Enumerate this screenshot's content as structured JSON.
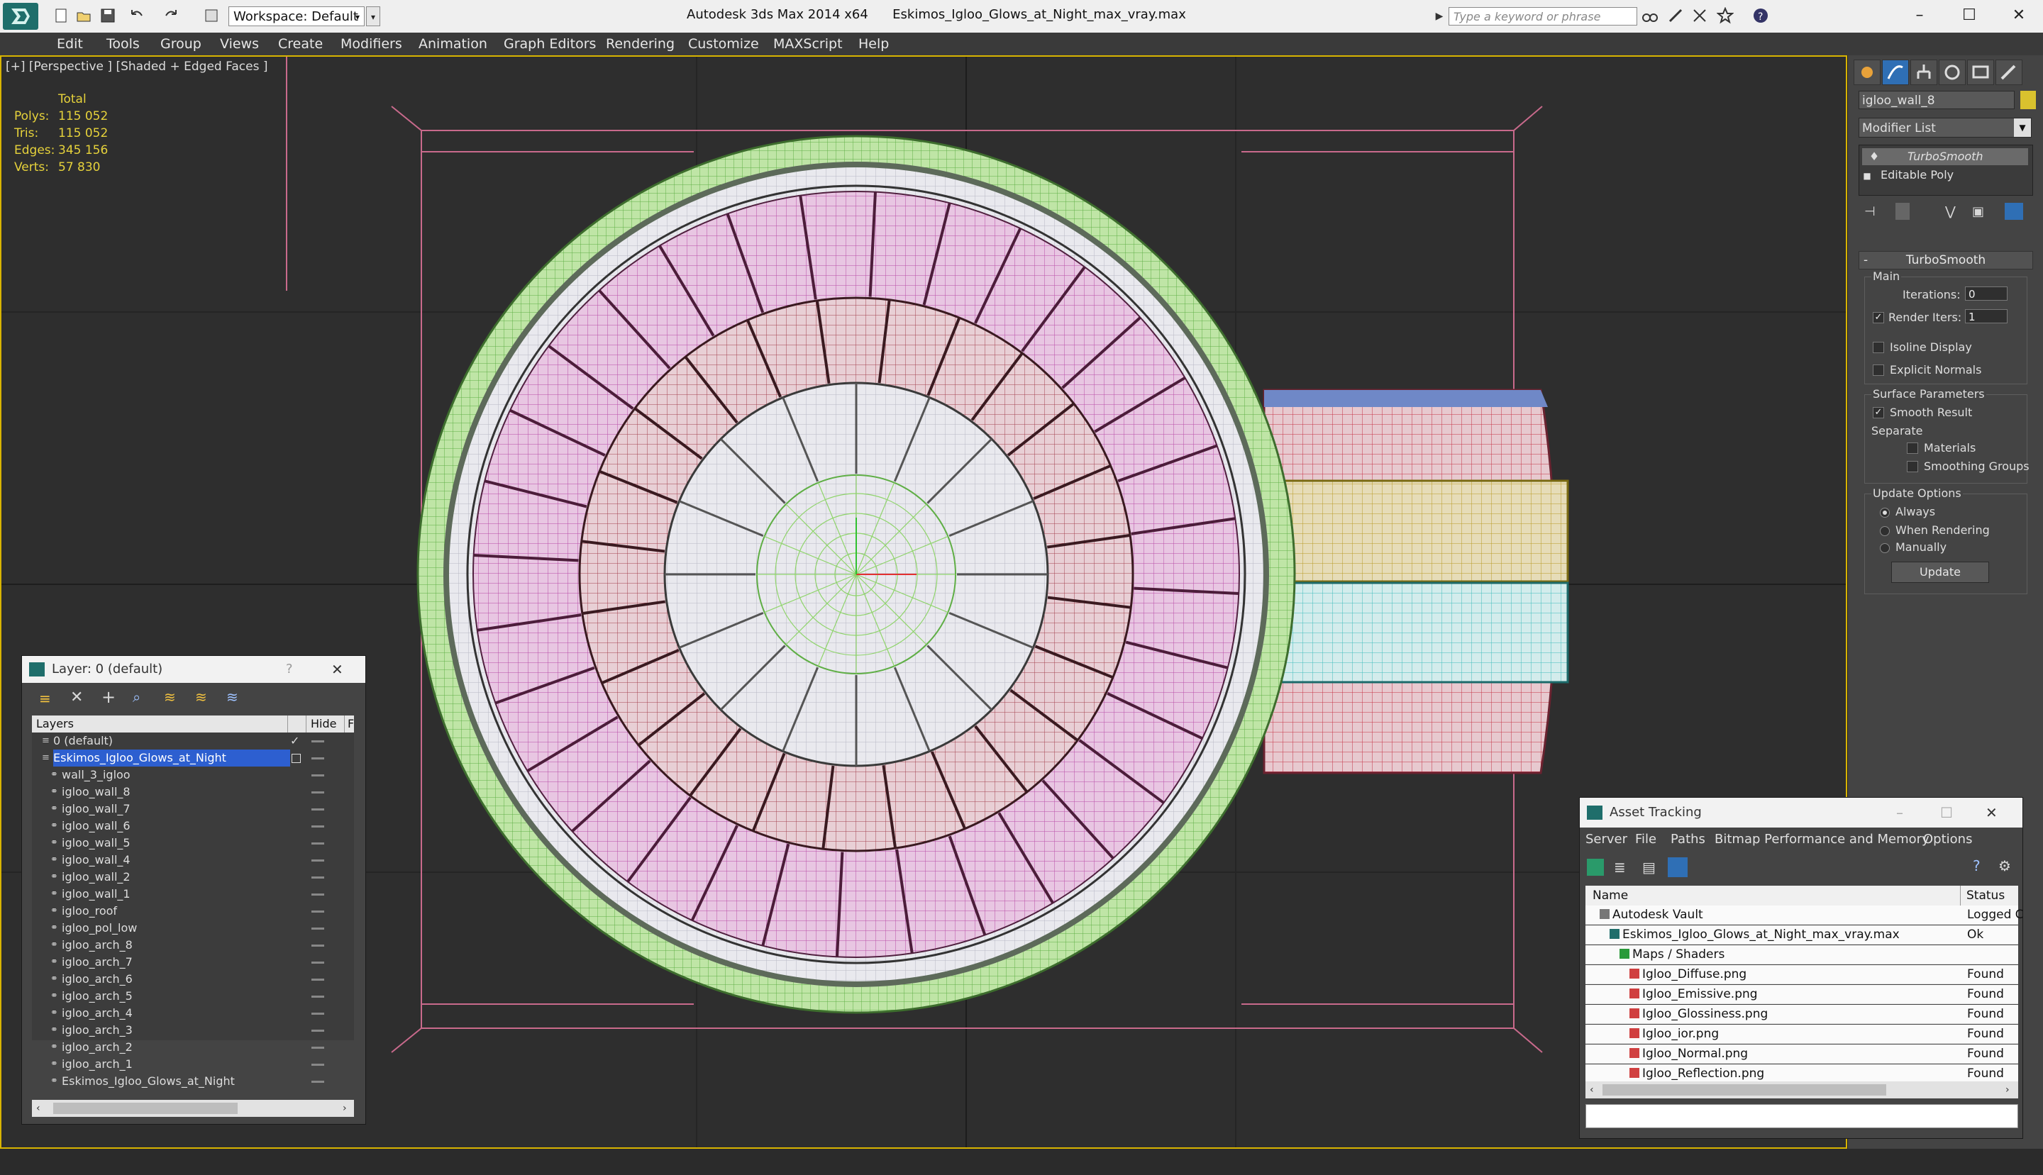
{
  "titlebar": {
    "workspace": "Workspace: Default",
    "title_app": "Autodesk 3ds Max  2014 x64",
    "title_file": "Eskimos_Igloo_Glows_at_Night_max_vray.max",
    "search_placeholder": "Type a keyword or phrase"
  },
  "menu": [
    "Edit",
    "Tools",
    "Group",
    "Views",
    "Create",
    "Modifiers",
    "Animation",
    "Graph Editors",
    "Rendering",
    "Customize",
    "MAXScript",
    "Help"
  ],
  "viewport": {
    "label": "[+] [Perspective ] [Shaded + Edged Faces ]",
    "stats_header": "Total",
    "stats": [
      {
        "key": "Polys:",
        "value": "115 052"
      },
      {
        "key": "Tris:",
        "value": "115 052"
      },
      {
        "key": "Edges:",
        "value": "345 156"
      },
      {
        "key": "Verts:",
        "value": "57 830"
      }
    ]
  },
  "command_panel": {
    "object_name": "igloo_wall_8",
    "object_color": "#d9c22e",
    "modifier_list": "Modifier List",
    "stack": [
      "TurboSmooth",
      "Editable Poly"
    ],
    "rollout": "TurboSmooth",
    "main_group": "Main",
    "iterations_label": "Iterations:",
    "iterations_value": "0",
    "render_iters_label": "Render Iters:",
    "render_iters_value": "1",
    "isoline": "Isoline Display",
    "explicit_normals": "Explicit Normals",
    "surface_params": "Surface Parameters",
    "smooth_result": "Smooth Result",
    "separate": "Separate",
    "materials": "Materials",
    "smoothing_groups": "Smoothing Groups",
    "update_options": "Update Options",
    "always": "Always",
    "when_rendering": "When Rendering",
    "manually": "Manually",
    "update_btn": "Update"
  },
  "layer_window": {
    "title": "Layer: 0 (default)",
    "help": "?",
    "col_layers": "Layers",
    "col_hide": "Hide",
    "col_f": "F",
    "rows": [
      {
        "name": "0 (default)",
        "indent": 1,
        "check": "✓"
      },
      {
        "name": "Eskimos_Igloo_Glows_at_Night",
        "indent": 1,
        "selected": true
      },
      {
        "name": "wall_3_igloo",
        "indent": 2
      },
      {
        "name": "igloo_wall_8",
        "indent": 2
      },
      {
        "name": "igloo_wall_7",
        "indent": 2
      },
      {
        "name": "igloo_wall_6",
        "indent": 2
      },
      {
        "name": "igloo_wall_5",
        "indent": 2
      },
      {
        "name": "igloo_wall_4",
        "indent": 2
      },
      {
        "name": "igloo_wall_2",
        "indent": 2
      },
      {
        "name": "igloo_wall_1",
        "indent": 2
      },
      {
        "name": "igloo_roof",
        "indent": 2
      },
      {
        "name": "igloo_pol_low",
        "indent": 2
      },
      {
        "name": "igloo_arch_8",
        "indent": 2
      },
      {
        "name": "igloo_arch_7",
        "indent": 2
      },
      {
        "name": "igloo_arch_6",
        "indent": 2
      },
      {
        "name": "igloo_arch_5",
        "indent": 2
      },
      {
        "name": "igloo_arch_4",
        "indent": 2
      },
      {
        "name": "igloo_arch_3",
        "indent": 2
      },
      {
        "name": "igloo_arch_2",
        "indent": 2
      },
      {
        "name": "igloo_arch_1",
        "indent": 2
      },
      {
        "name": "Eskimos_Igloo_Glows_at_Night",
        "indent": 2
      }
    ]
  },
  "asset_window": {
    "title": "Asset Tracking",
    "menu": [
      "Server",
      "File",
      "Paths",
      "Bitmap Performance and Memory",
      "Options"
    ],
    "col_name": "Name",
    "col_status": "Status",
    "rows": [
      {
        "name": "Autodesk Vault",
        "status": "Logged C",
        "indent": 1
      },
      {
        "name": "Eskimos_Igloo_Glows_at_Night_max_vray.max",
        "status": "Ok",
        "indent": 2
      },
      {
        "name": "Maps / Shaders",
        "status": "",
        "indent": 3
      },
      {
        "name": "Igloo_Diffuse.png",
        "status": "Found",
        "indent": 4
      },
      {
        "name": "Igloo_Emissive.png",
        "status": "Found",
        "indent": 4
      },
      {
        "name": "Igloo_Glossiness.png",
        "status": "Found",
        "indent": 4
      },
      {
        "name": "Igloo_ior.png",
        "status": "Found",
        "indent": 4
      },
      {
        "name": "Igloo_Normal.png",
        "status": "Found",
        "indent": 4
      },
      {
        "name": "Igloo_Reflection.png",
        "status": "Found",
        "indent": 4
      }
    ]
  }
}
